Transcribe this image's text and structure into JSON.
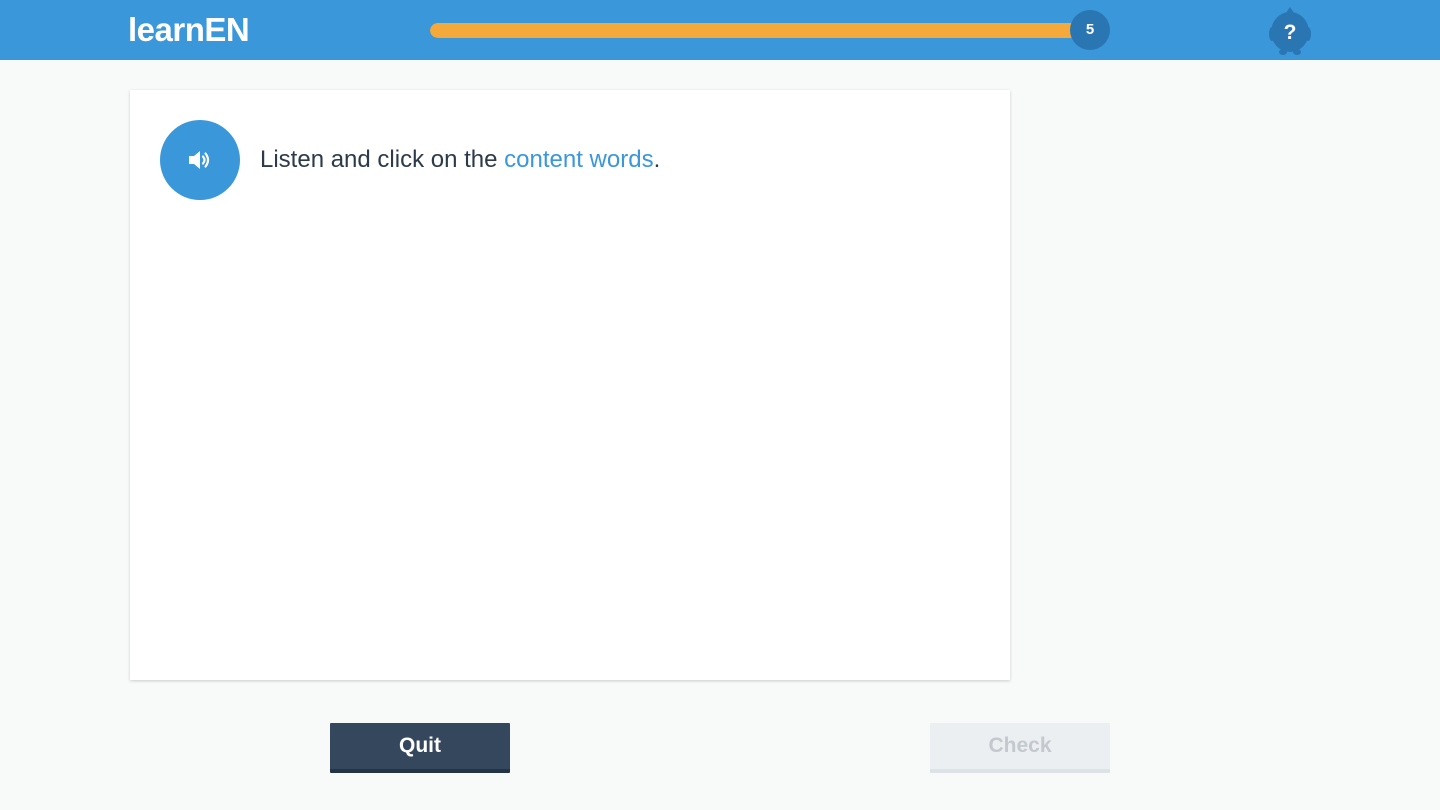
{
  "header": {
    "logo_text": "learnEN",
    "progress_percent": 100,
    "progress_count": "5",
    "help_icon": "help-question-icon"
  },
  "exercise": {
    "audio_icon": "speaker-icon",
    "instruction_prefix": "Listen and click on the ",
    "instruction_highlight": "content words",
    "instruction_suffix": "."
  },
  "footer": {
    "quit_label": "Quit",
    "check_label": "Check"
  },
  "colors": {
    "header_bg": "#3a97da",
    "progress_fill": "#f4a93a",
    "accent": "#3a97da",
    "quit_bg": "#34475d",
    "check_bg_disabled": "#eceff1"
  }
}
